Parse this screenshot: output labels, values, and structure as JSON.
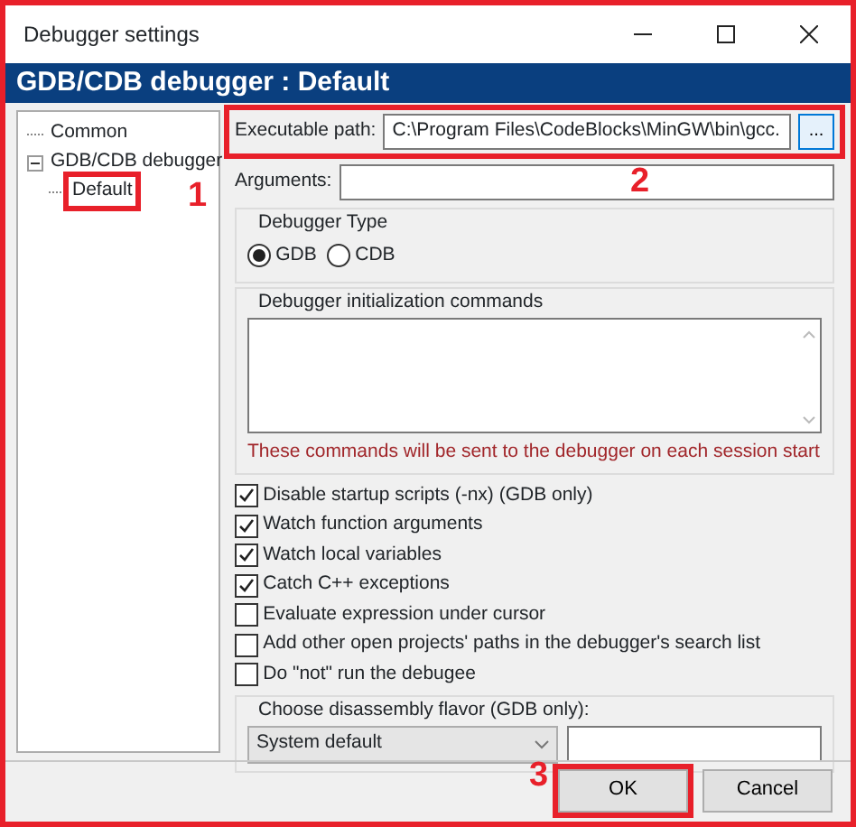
{
  "window": {
    "title": "Debugger settings"
  },
  "header": "GDB/CDB debugger : Default",
  "tree": [
    {
      "label": "Common"
    },
    {
      "label": "GDB/CDB debugger",
      "expanded": true,
      "children": [
        {
          "label": "Default",
          "annotation": "1"
        }
      ]
    }
  ],
  "executable_path": {
    "label": "Executable path:",
    "value": "C:\\Program Files\\CodeBlocks\\MinGW\\bin\\gcc.",
    "browse": "...",
    "annotation": "2"
  },
  "arguments": {
    "label": "Arguments:"
  },
  "debugger_type": {
    "title": "Debugger Type",
    "options": [
      {
        "label": "GDB",
        "selected": true
      },
      {
        "label": "CDB",
        "selected": false
      }
    ]
  },
  "init_commands": {
    "title": "Debugger initialization commands",
    "note": "These commands will be sent to the debugger on each session start"
  },
  "options": [
    {
      "label": "Disable startup scripts (-nx) (GDB only)",
      "checked": true
    },
    {
      "label": "Watch function arguments",
      "checked": true
    },
    {
      "label": "Watch local variables",
      "checked": true
    },
    {
      "label": "Catch C++ exceptions",
      "checked": true
    },
    {
      "label": "Evaluate expression under cursor",
      "checked": false
    },
    {
      "label": "Add other open projects' paths in the debugger's search list",
      "checked": false
    },
    {
      "label": "Do \"not\" run the debugee",
      "checked": false
    }
  ],
  "disassembly": {
    "title": "Choose disassembly flavor (GDB only):",
    "value": "System default"
  },
  "buttons": [
    {
      "label": "OK",
      "annotation": "3"
    },
    {
      "label": "Cancel"
    }
  ]
}
